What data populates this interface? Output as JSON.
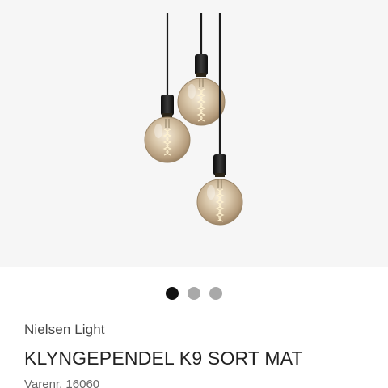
{
  "product": {
    "image_alt": "pendant-lamp-cluster",
    "brand": "Nielsen Light",
    "title": "KLYNGEPENDEL K9 SORT MAT",
    "sku": "Varenr. 16060"
  },
  "carousel": {
    "dot_count": 3,
    "active_index": 0
  },
  "colors": {
    "panel_bg": "#f6f6f6",
    "cord": "#1a1a1a",
    "dot_active": "#111111",
    "dot_inactive": "#a9a9a9",
    "bulb_glass": "#c8b49a",
    "filament": "#fff2d0"
  }
}
